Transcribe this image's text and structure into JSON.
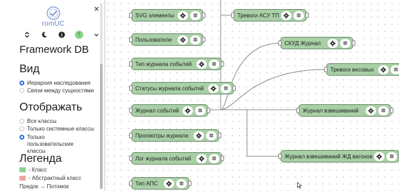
{
  "sidebar": {
    "close_label": "×",
    "logo_text": "romUC",
    "title": "Framework DB",
    "view": {
      "heading": "Вид",
      "options": [
        {
          "label": "Иерархия наследования",
          "checked": true
        },
        {
          "label": "Связи между сущностями",
          "checked": false
        }
      ]
    },
    "display": {
      "heading": "Отображать",
      "options": [
        {
          "label": "Все классы",
          "checked": false
        },
        {
          "label": "Только системные классы",
          "checked": false
        },
        {
          "label": "Только пользовательские классы",
          "checked": true
        }
      ]
    },
    "legend": {
      "heading": "Легенда",
      "items": [
        {
          "label": "- Класс",
          "color": "#8fcf8f"
        },
        {
          "label": "- Абстрактный класс",
          "color": "#f2a3a3"
        }
      ],
      "arrow_text": "Предок → Потомок"
    },
    "icons": [
      "chevron-updown-icon",
      "moon-icon",
      "info-icon",
      "user-avatar",
      "chevron-down-icon"
    ],
    "avatar_letter": "T"
  },
  "nodes": [
    {
      "id": "svg",
      "label": "SVG элементы"
    },
    {
      "id": "users",
      "label": "Пользователи"
    },
    {
      "id": "event-journal-type",
      "label": "Тип журнала событий"
    },
    {
      "id": "event-journal-statuses",
      "label": "Статусы журнала событий"
    },
    {
      "id": "event-journal",
      "label": "Журнал событий"
    },
    {
      "id": "journal-views",
      "label": "Просмотры журнала"
    },
    {
      "id": "event-journal-log",
      "label": "Лог журнала событий"
    },
    {
      "id": "aps-type",
      "label": "Тип АПС"
    },
    {
      "id": "asu-alarms",
      "label": "Тревоги АСУ ТП"
    },
    {
      "id": "skud-journal",
      "label": "СКУД Журнал"
    },
    {
      "id": "weigher-alarms",
      "label": "Тревоги весовых"
    },
    {
      "id": "weighing-journal",
      "label": "Журнал взвешиваний"
    },
    {
      "id": "rail-weighing-journal",
      "label": "Журнал взвешиваний ЖД вагонов"
    }
  ],
  "colors": {
    "node_fill": "#a8cfa6",
    "node_border": "#6f8f6d",
    "link": "#8c8c8c",
    "accent": "#2f6de0"
  }
}
